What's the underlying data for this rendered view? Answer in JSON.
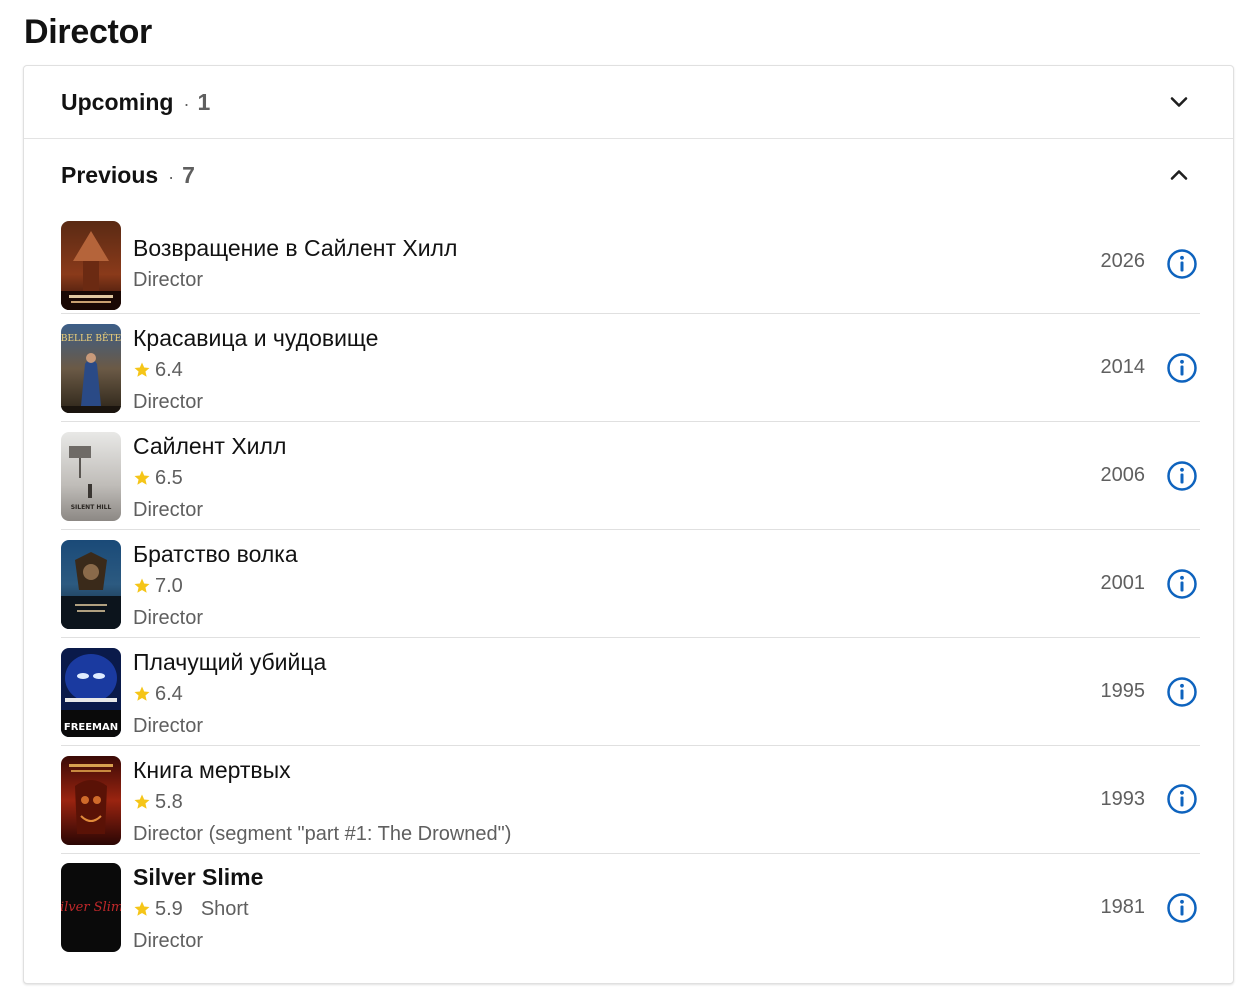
{
  "section_title": "Director",
  "upcoming": {
    "label": "Upcoming",
    "separator": "·",
    "count": "1"
  },
  "previous": {
    "label": "Previous",
    "separator": "·",
    "count": "7"
  },
  "films": [
    {
      "title": "Возвращение в Сайлент Хилл",
      "rating": "",
      "type": "",
      "role": "Director",
      "year": "2026"
    },
    {
      "title": "Красавица и чудовище",
      "rating": "6.4",
      "type": "",
      "role": "Director",
      "year": "2014"
    },
    {
      "title": "Сайлент Хилл",
      "rating": "6.5",
      "type": "",
      "role": "Director",
      "year": "2006"
    },
    {
      "title": "Братство волка",
      "rating": "7.0",
      "type": "",
      "role": "Director",
      "year": "2001"
    },
    {
      "title": "Плачущий убийца",
      "rating": "6.4",
      "type": "",
      "role": "Director",
      "year": "1995"
    },
    {
      "title": "Книга мертвых",
      "rating": "5.8",
      "type": "",
      "role": "Director (segment \"part #1: The Drowned\")",
      "year": "1993"
    },
    {
      "title": "Silver Slime",
      "rating": "5.9",
      "type": "Short",
      "role": "Director",
      "year": "1981"
    }
  ],
  "poster_text": {
    "belle": "BELLE BÊTE",
    "silent": "SILENT HILL",
    "freeman": "FREEMAN",
    "silver": "Silver Slime"
  },
  "colors": {
    "accent": "#0e63be",
    "star": "#f5c518",
    "text": "#121212",
    "muted": "#5f5f5f"
  }
}
